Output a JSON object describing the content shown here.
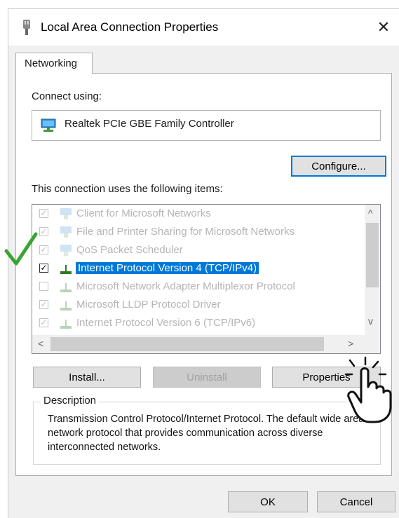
{
  "window": {
    "title": "Local Area Connection Properties",
    "close_symbol": "✕"
  },
  "tabs": [
    {
      "label": "Networking",
      "active": true
    }
  ],
  "connect_using": {
    "label": "Connect using:",
    "adapter_name": "Realtek PCIe GBE Family Controller",
    "adapter_icon": "network-adapter-icon",
    "configure_label": "Configure..."
  },
  "items_section": {
    "label": "This connection uses the following items:",
    "items": [
      {
        "label": "Client for Microsoft Networks",
        "checked": true,
        "selected": false
      },
      {
        "label": "File and Printer Sharing for Microsoft Networks",
        "checked": true,
        "selected": false
      },
      {
        "label": "QoS Packet Scheduler",
        "checked": true,
        "selected": false
      },
      {
        "label": "Internet Protocol Version 4 (TCP/IPv4)",
        "checked": true,
        "selected": true
      },
      {
        "label": "Microsoft Network Adapter Multiplexor Protocol",
        "checked": false,
        "selected": false
      },
      {
        "label": "Microsoft LLDP Protocol Driver",
        "checked": true,
        "selected": false
      },
      {
        "label": "Internet Protocol Version 6 (TCP/IPv6)",
        "checked": true,
        "selected": false
      }
    ]
  },
  "buttons": {
    "install": "Install...",
    "uninstall": "Uninstall",
    "properties": "Properties",
    "ok": "OK",
    "cancel": "Cancel"
  },
  "description": {
    "legend": "Description",
    "text": "Transmission Control Protocol/Internet Protocol. The default wide area network protocol that provides communication across diverse interconnected networks."
  },
  "colors": {
    "selection": "#0078d7",
    "annotation_check": "#3aa335"
  }
}
